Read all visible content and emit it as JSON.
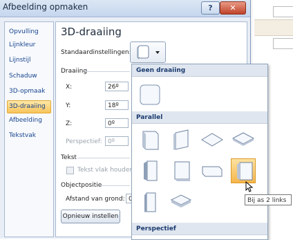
{
  "dialog": {
    "title": "Afbeelding opmaken",
    "help_label": "?",
    "close_label": "✕"
  },
  "nav": {
    "items": [
      {
        "label": "Opvulling"
      },
      {
        "label": "Lijnkleur"
      },
      {
        "label": "Lijnstijl"
      },
      {
        "label": "Schaduw"
      },
      {
        "label": "3D-opmaak"
      },
      {
        "label": "3D-draaiing"
      },
      {
        "label": "Afbeelding"
      },
      {
        "label": "Tekstvak"
      }
    ],
    "selected": "3D-draaiing"
  },
  "main": {
    "heading": "3D-draaiing",
    "preset_label": "Standaardinstellingen:",
    "rotation": {
      "section": "Draaiing",
      "x_label": "X:",
      "x_value": "26º",
      "y_label": "Y:",
      "y_value": "18º",
      "z_label": "Z:",
      "z_value": "0º",
      "perspective_label": "Perspectief:",
      "perspective_value": "0º"
    },
    "text": {
      "section": "Tekst",
      "keep_flat_label": "Tekst vlak houden"
    },
    "object_position": {
      "section": "Objectpositie",
      "distance_label": "Afstand van grond:",
      "distance_value": "0"
    },
    "reset_button": "Opnieuw instellen"
  },
  "gallery": {
    "sections": [
      {
        "title": "Geen draaiing"
      },
      {
        "title": "Parallel"
      },
      {
        "title": "Perspectief"
      }
    ],
    "tooltip": "Bij as 2 links"
  },
  "colors": {
    "accent": "#16438f",
    "selected_bg": "#f8c45b"
  }
}
